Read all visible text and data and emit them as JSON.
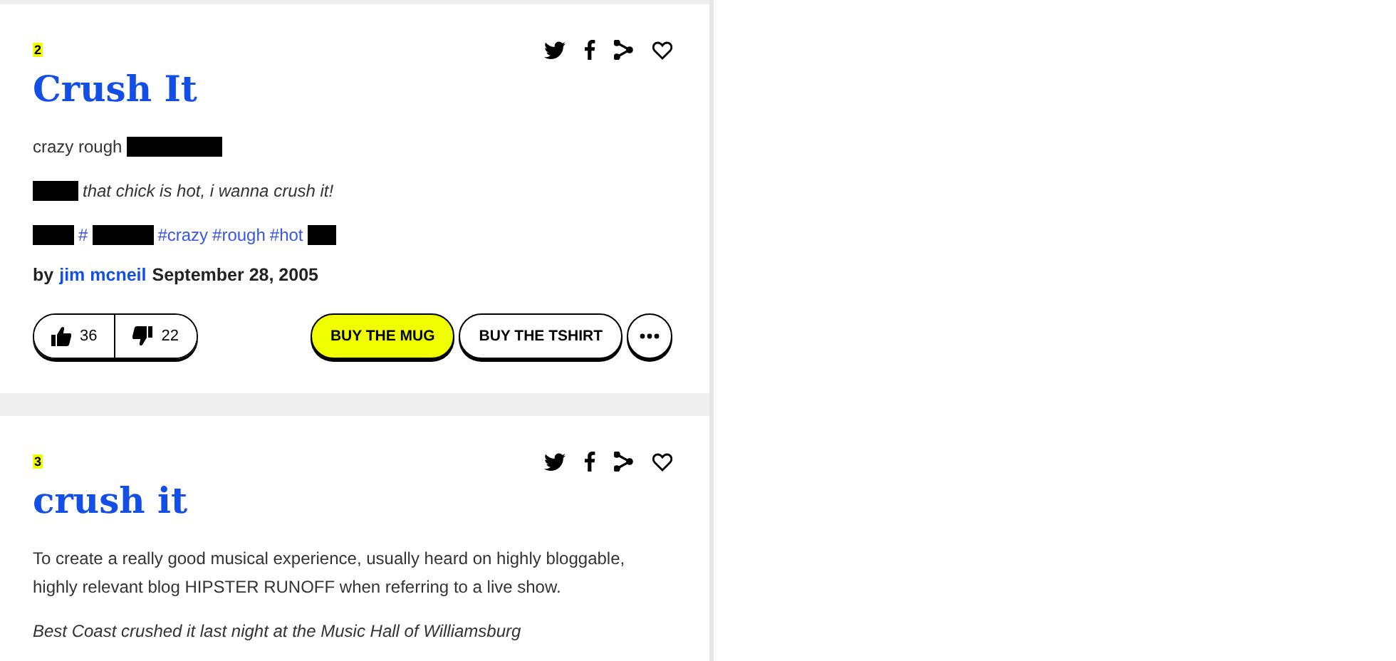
{
  "entries": [
    {
      "rank": "2",
      "word": "Crush It",
      "meaning": [
        {
          "kind": "text",
          "text": "crazy rough"
        },
        {
          "kind": "redacted"
        }
      ],
      "example": [
        {
          "kind": "redacted"
        },
        {
          "kind": "text",
          "text": "that chick is hot, i wanna crush it!"
        }
      ],
      "tags": [
        {
          "kind": "redacted"
        },
        {
          "kind": "tag",
          "text": "#"
        },
        {
          "kind": "redacted"
        },
        {
          "kind": "tag",
          "text": "#crazy"
        },
        {
          "kind": "tag",
          "text": "#rough"
        },
        {
          "kind": "tag",
          "text": "#hot"
        },
        {
          "kind": "redacted"
        }
      ],
      "byline": {
        "prefix": "by",
        "author": "jim mcneil",
        "date": "September 28, 2005"
      },
      "votes": {
        "up": "36",
        "down": "22"
      },
      "buttons": [
        {
          "label": "BUY THE MUG",
          "kind": "primary"
        },
        {
          "label": "BUY THE TSHIRT",
          "kind": "plain"
        }
      ]
    },
    {
      "rank": "3",
      "word": "crush it",
      "meaning": [
        {
          "kind": "text",
          "text": "To create a really good musical experience, usually heard on highly bloggable, highly relevant blog HIPSTER RUNOFF when referring to a live show."
        }
      ],
      "example": [
        {
          "kind": "text",
          "text": "Best Coast crushed it last night at the Music Hall of Williamsburg"
        }
      ]
    }
  ]
}
